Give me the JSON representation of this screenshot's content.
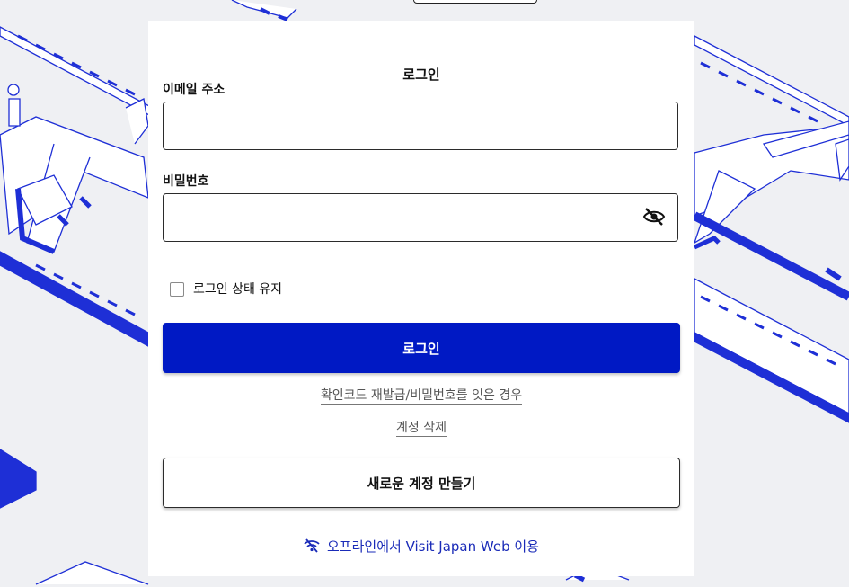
{
  "login": {
    "title": "로그인",
    "email_label": "이메일 주소",
    "email_value": "",
    "password_label": "비밀번호",
    "password_value": "",
    "remember_label": "로그인 상태 유지",
    "remember_checked": false,
    "submit_label": "로그인",
    "reset_link": "확인코드 재발급/비밀번호를 잊은 경우",
    "delete_link": "계정 삭제",
    "create_label": "새로운 계정 만들기",
    "offline_label": "오프라인에서 Visit Japan Web 이용"
  },
  "icons": {
    "password_toggle": "eye-off-icon",
    "offline": "wifi-off-icon"
  },
  "colors": {
    "primary": "#0019c4",
    "link_blue": "#1a2bb8",
    "background": "#eff0f3",
    "illustration": "#1e2fd6"
  }
}
